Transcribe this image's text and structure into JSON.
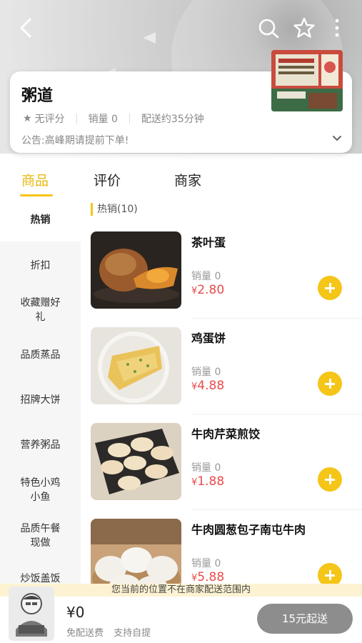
{
  "shop": {
    "name": "粥道",
    "rating": "无评分",
    "sales": "销量 0",
    "delivery_time": "配送约35分钟",
    "notice": "公告:高峰期请提前下单!"
  },
  "tabs": [
    {
      "label": "商品",
      "active": true
    },
    {
      "label": "评价",
      "active": false
    },
    {
      "label": "商家",
      "active": false
    }
  ],
  "sidebar": {
    "items": [
      {
        "label": "热销",
        "active": true
      },
      {
        "label": "折扣"
      },
      {
        "label": "收藏赠好礼"
      },
      {
        "label": "品质蒸品"
      },
      {
        "label": "招牌大饼"
      },
      {
        "label": "营养粥品"
      },
      {
        "label": "特色小鸡小鱼"
      },
      {
        "label": "品质午餐现做"
      },
      {
        "label": "炒饭盖饭"
      }
    ]
  },
  "section": {
    "title": "热销(10)"
  },
  "products": [
    {
      "name": "茶叶蛋",
      "sold": "销量 0",
      "currency": "¥",
      "price": "2.80",
      "icon": "tea-egg-image"
    },
    {
      "name": "鸡蛋饼",
      "sold": "销量 0",
      "currency": "¥",
      "price": "4.88",
      "icon": "egg-pancake-image"
    },
    {
      "name": "牛肉芹菜煎饺",
      "sold": "销量 0",
      "currency": "¥",
      "price": "1.88",
      "icon": "dumpling-image"
    },
    {
      "name": "牛肉圆葱包子南屯牛肉",
      "sold": "销量 0",
      "currency": "¥",
      "price": "5.88",
      "icon": "bun-image"
    }
  ],
  "warning": "您当前的位置不在商家配送范围内",
  "cart": {
    "total": "¥0",
    "free_delivery": "免配送费",
    "self_pickup": "支持自提",
    "checkout_label": "15元起送"
  },
  "colors": {
    "accent": "#f5c518",
    "active_tab": "#e8b90f",
    "price": "#e64c4c",
    "checkout_disabled": "#8d8d8d"
  }
}
